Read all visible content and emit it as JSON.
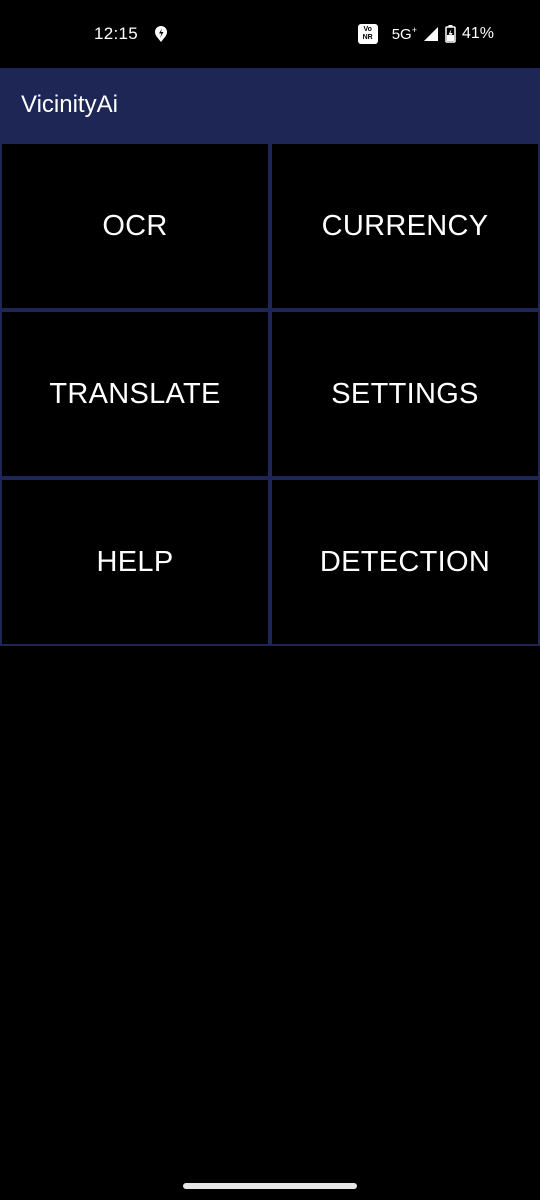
{
  "status_bar": {
    "time": "12:15",
    "vonr_top": "Vo",
    "vonr_bottom": "NR",
    "network": "5G",
    "network_sup": "+",
    "battery": "41%"
  },
  "app_bar": {
    "title": "VicinityAi"
  },
  "menu": {
    "items": [
      {
        "label": "OCR"
      },
      {
        "label": "CURRENCY"
      },
      {
        "label": "TRANSLATE"
      },
      {
        "label": "SETTINGS"
      },
      {
        "label": "HELP"
      },
      {
        "label": "DETECTION"
      }
    ]
  },
  "colors": {
    "app_bar": "#1e2656",
    "tile_border": "#1e2656",
    "background": "#000000",
    "text": "#ffffff"
  }
}
